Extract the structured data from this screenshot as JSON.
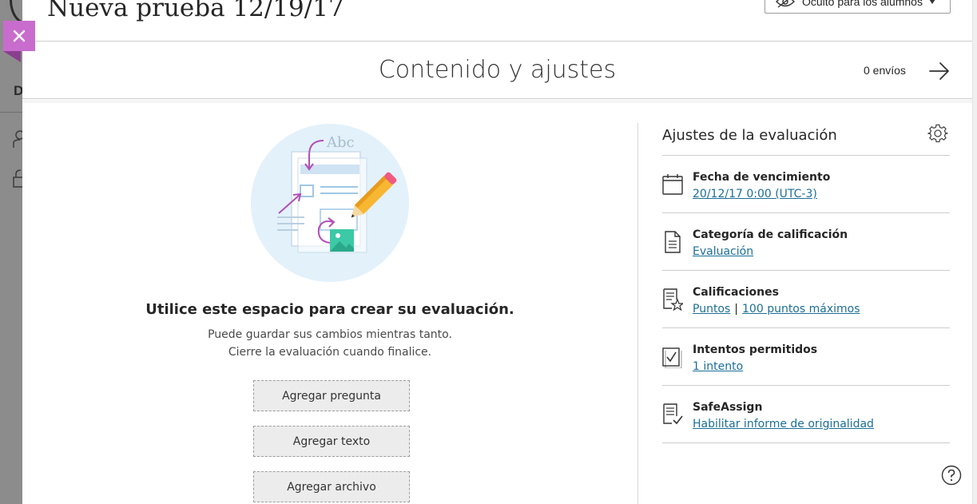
{
  "page": {
    "title": "Nueva prueba 12/19/17",
    "visibility": "Oculto para los alumnos",
    "background_letter": "D"
  },
  "section": {
    "title": "Contenido y ajustes",
    "submissions": "0 envíos"
  },
  "create": {
    "heading": "Utilice este espacio para crear su evaluación.",
    "line1": "Puede guardar sus cambios mientras tanto.",
    "line2": "Cierre la evaluación cuando finalice.",
    "illustration_text": "Abc",
    "buttons": {
      "add_question": "Agregar pregunta",
      "add_text": "Agregar texto",
      "add_file": "Agregar archivo"
    }
  },
  "settings": {
    "title": "Ajustes de la evaluación",
    "items": [
      {
        "label": "Fecha de vencimiento",
        "value": "20/12/17 0:00 (UTC-3)",
        "icon": "calendar-icon"
      },
      {
        "label": "Categoría de calificación",
        "value": "Evaluación",
        "icon": "document-icon"
      },
      {
        "label": "Calificaciones",
        "value": "Puntos",
        "value2": "100 puntos máximos",
        "separator": "|",
        "icon": "grade-star-icon"
      },
      {
        "label": "Intentos permitidos",
        "value": "1 intento",
        "icon": "checkbox-icon"
      },
      {
        "label": "SafeAssign",
        "value": "Habilitar informe de originalidad",
        "icon": "safeassign-icon"
      }
    ]
  },
  "colors": {
    "accent_purple": "#c86ccd",
    "link_blue": "#1b6f99",
    "illustration_bg": "#e3f1fb"
  }
}
